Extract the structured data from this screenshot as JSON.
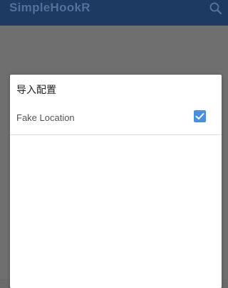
{
  "app": {
    "title": "SimpleHookR",
    "search_icon": "search-icon"
  },
  "colors": {
    "appbar_bg": "#1d3a63",
    "accent": "#4a90e2",
    "overlay": "#6f6f6f"
  },
  "dialog": {
    "title": "导入配置",
    "items": [
      {
        "label": "Fake Location",
        "checked": true
      }
    ]
  }
}
